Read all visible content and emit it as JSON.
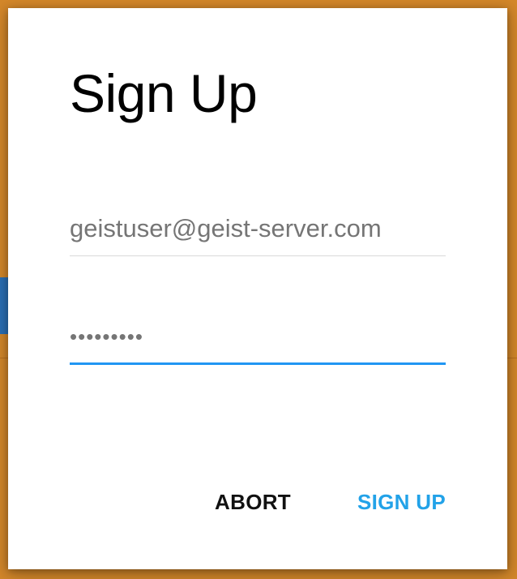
{
  "dialog": {
    "title": "Sign Up",
    "email_field": {
      "value": "geistuser@geist-server.com",
      "placeholder": ""
    },
    "password_field": {
      "value": "•••••••••",
      "placeholder": ""
    },
    "abort_label": "ABORT",
    "sign_up_label": "SIGN UP"
  },
  "colors": {
    "backdrop": "#d3872a",
    "accent": "#2196f3",
    "primary_button": "#22a2e8"
  }
}
